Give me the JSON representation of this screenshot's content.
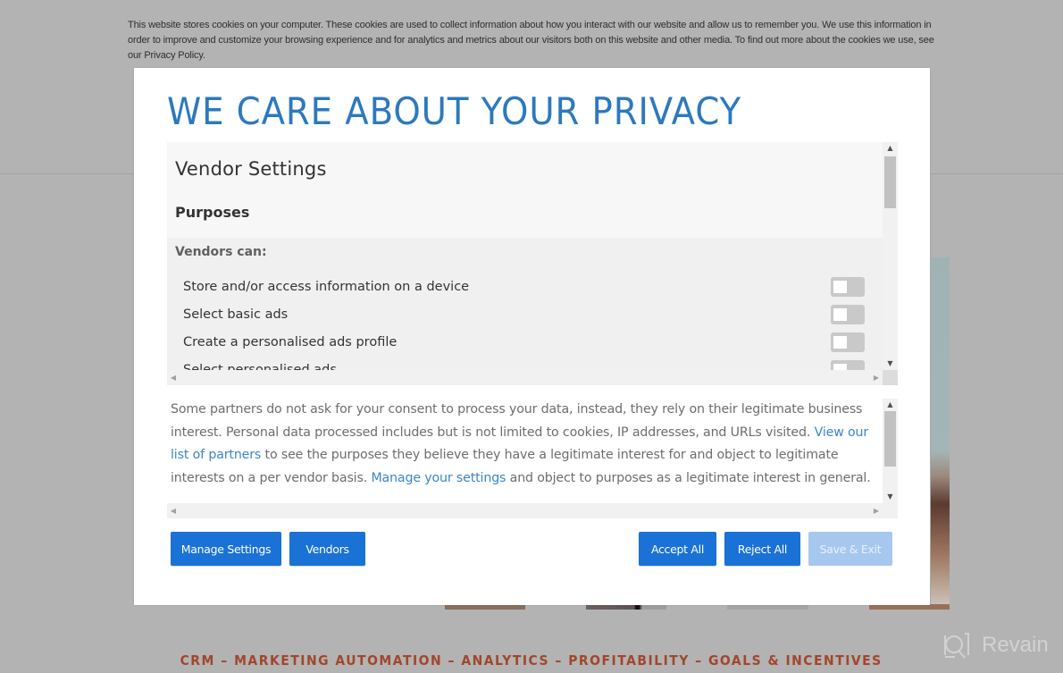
{
  "cookie_banner": {
    "text": "This website stores cookies on your computer. These cookies are used to collect information about how you interact with our website and allow us to remember you. We use this information in order to improve and customize your browsing experience and for analytics and metrics about our visitors both on this website and other media. To find out more about the cookies we use, see our Privacy Policy."
  },
  "modal": {
    "title": "WE CARE ABOUT YOUR PRIVACY",
    "vendor_settings": {
      "title": "Vendor Settings",
      "purposes_heading": "Purposes",
      "vendors_can_label": "Vendors can:",
      "purposes": [
        {
          "label": "Store and/or access information on a device",
          "enabled": false
        },
        {
          "label": "Select basic ads",
          "enabled": false
        },
        {
          "label": "Create a personalised ads profile",
          "enabled": false
        },
        {
          "label": "Select personalised ads",
          "enabled": false
        }
      ]
    },
    "legitimate_interest": {
      "text_1": "Some partners do not ask for your consent to process your data, instead, they rely on their legitimate business interest. Personal data processed includes but is not limited to cookies, IP addresses, and URLs visited. ",
      "link_partners": "View our list of partners",
      "text_2": " to see the purposes they believe they have a legitimate interest for and object to legitimate interests on a per vendor basis. ",
      "link_settings": "Manage your settings",
      "text_3": " and object to purposes as a legitimate interest in general."
    },
    "buttons": {
      "manage_settings": "Manage Settings",
      "vendors": "Vendors",
      "accept_all": "Accept All",
      "reject_all": "Reject All",
      "save_exit": "Save & Exit"
    },
    "colors": {
      "accent": "#1a72d6",
      "accent_disabled": "#a6c8ef",
      "title": "#2c79be",
      "link": "#3a86c8"
    }
  },
  "background_page": {
    "tagline": "CRM – MARKETING AUTOMATION – ANALYTICS – PROFITABILITY – GOALS & INCENTIVES",
    "tagline_color": "#a2462c"
  },
  "watermark": {
    "label": "Revain"
  },
  "scroll_icons": {
    "up": "▲",
    "down": "▼",
    "left": "◀",
    "right": "▶"
  }
}
